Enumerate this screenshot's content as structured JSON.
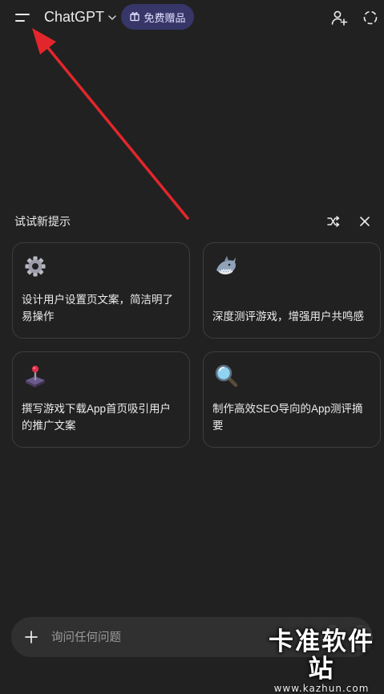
{
  "header": {
    "app_title": "ChatGPT",
    "gift_label": "免费赠品",
    "icons": {
      "menu": "menu-icon",
      "chevron": "chevron-down-icon",
      "gift": "gift-icon",
      "add_user": "add-user-icon",
      "temp_chat": "temporary-chat-icon"
    }
  },
  "suggestions": {
    "header": "试试新提示",
    "cards": [
      {
        "icon": "gear-icon",
        "text": "设计用户设置页文案，简洁明了易操作"
      },
      {
        "icon": "shark-icon",
        "text": "深度测评游戏，增强用户共鸣感"
      },
      {
        "icon": "joystick-icon",
        "text": "撰写游戏下载App首页吸引用户的推广文案"
      },
      {
        "icon": "magnifier-icon",
        "text": "制作高效SEO导向的App测评摘要"
      }
    ]
  },
  "composer": {
    "placeholder": "询问任何问题"
  },
  "watermark": {
    "title": "卡准软件站",
    "url": "www.kazhun.com"
  },
  "colors": {
    "background": "#212121",
    "card_border": "#3d3d3d",
    "gift_pill": "#373669",
    "composer": "#303030",
    "annotation_arrow": "#e3262c"
  }
}
